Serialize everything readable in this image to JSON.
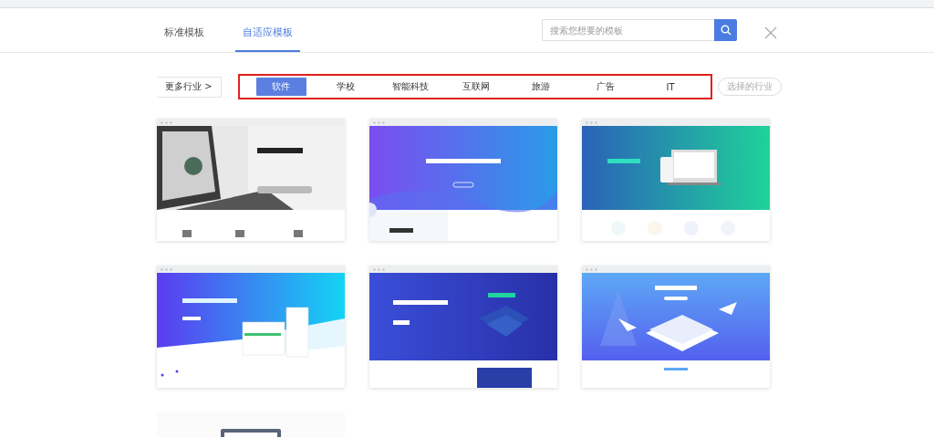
{
  "tabs": [
    {
      "label": "标准模板",
      "selected": false
    },
    {
      "label": "自适应模板",
      "selected": true
    }
  ],
  "search": {
    "placeholder": "搜索您想要的模板"
  },
  "more_button": "更多行业 >",
  "categories": [
    {
      "label": "软件",
      "selected": true
    },
    {
      "label": "学校",
      "selected": false
    },
    {
      "label": "智能科技",
      "selected": false
    },
    {
      "label": "互联网",
      "selected": false
    },
    {
      "label": "旅游",
      "selected": false
    },
    {
      "label": "广告",
      "selected": false
    },
    {
      "label": "IT",
      "selected": false
    }
  ],
  "other_button": "选择的行业",
  "templates": [
    {
      "kind": "preview"
    },
    {
      "kind": "preview"
    },
    {
      "kind": "preview"
    },
    {
      "kind": "preview"
    },
    {
      "kind": "preview"
    },
    {
      "kind": "preview"
    },
    {
      "kind": "blank"
    }
  ]
}
